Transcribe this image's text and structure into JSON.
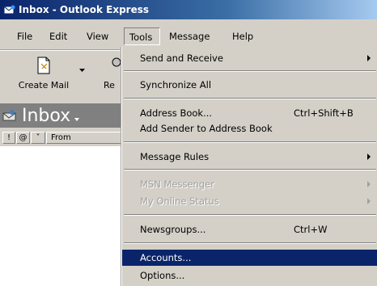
{
  "window": {
    "title": "Inbox - Outlook Express"
  },
  "menu": {
    "file": "File",
    "edit": "Edit",
    "view": "View",
    "tools": "Tools",
    "message": "Message",
    "help": "Help"
  },
  "toolbar": {
    "create_mail": "Create Mail",
    "reply_partial": "Re"
  },
  "folder": {
    "name": "Inbox"
  },
  "columns": {
    "priority": "!",
    "attachment": "@",
    "flag": "˅",
    "from": "From"
  },
  "tools_menu": {
    "send_receive": "Send and Receive",
    "synchronize_all": "Synchronize All",
    "address_book": "Address Book...",
    "address_book_shortcut": "Ctrl+Shift+B",
    "add_sender": "Add Sender to Address Book",
    "message_rules": "Message Rules",
    "msn_messenger": "MSN Messenger",
    "my_online_status": "My Online Status",
    "newsgroups": "Newsgroups...",
    "newsgroups_shortcut": "Ctrl+W",
    "accounts": "Accounts...",
    "options": "Options..."
  },
  "colors": {
    "highlight": "#0a246a",
    "menu_bg": "#d4d0c8",
    "folder_bar": "#808080"
  }
}
